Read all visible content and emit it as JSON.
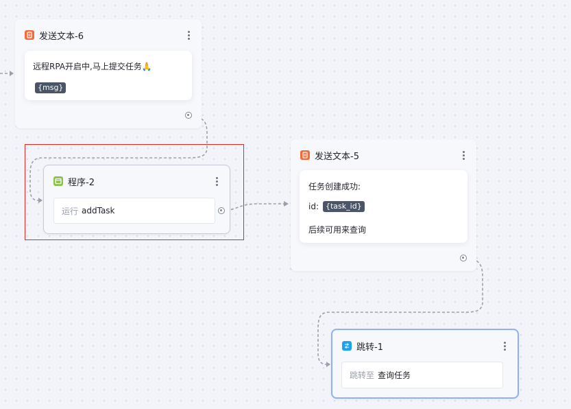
{
  "colors": {
    "send_icon": "#f26b3a",
    "program_icon": "#8bc34a",
    "jump_icon": "#1da1f2",
    "highlight_frame": "#e0281f",
    "wire": "#9aa0ab"
  },
  "nodes": {
    "send_text_6": {
      "title": "发送文本-6",
      "icon": "message-doc-icon",
      "message": "远程RPA开启中,马上提交任务🙏",
      "variable": "{msg}"
    },
    "program_2": {
      "title": "程序-2",
      "icon": "program-window-icon",
      "action_verb": "运行",
      "action_target": "addTask"
    },
    "send_text_5": {
      "title": "发送文本-5",
      "icon": "message-doc-icon",
      "line1": "任务创建成功:",
      "id_label": "id:",
      "id_variable": "{task_id}",
      "line3": "后续可用来查询"
    },
    "jump_1": {
      "title": "跳转-1",
      "icon": "jump-arrow-icon",
      "action_verb": "跳转至",
      "action_target": "查询任务"
    }
  }
}
